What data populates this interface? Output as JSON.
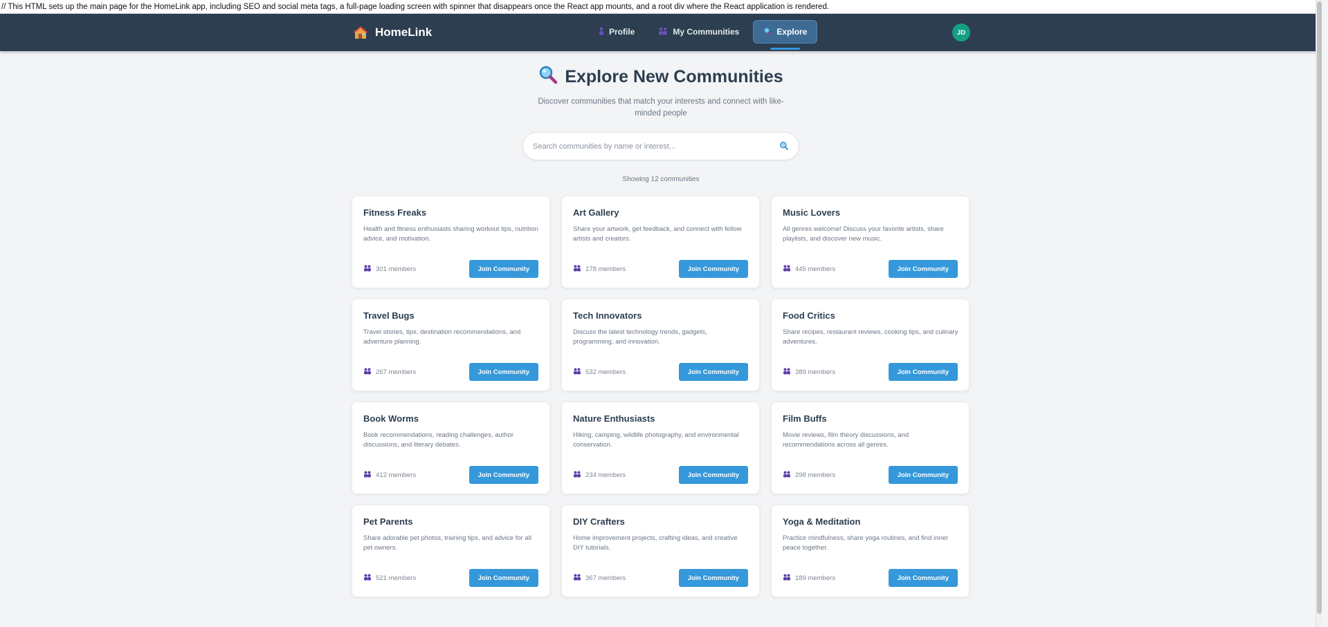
{
  "comment": "// This HTML sets up the main page for the HomeLink app, including SEO and social meta tags, a full-page loading screen with spinner that disappears once the React app mounts, and a root div where the React application is rendered.",
  "brand": {
    "name": "HomeLink",
    "icon": "house-icon"
  },
  "nav": {
    "items": [
      {
        "label": "Profile",
        "icon": "person-icon",
        "active": false
      },
      {
        "label": "My Communities",
        "icon": "people-icon",
        "active": false
      },
      {
        "label": "Explore",
        "icon": "search-icon",
        "active": true
      }
    ]
  },
  "user": {
    "initials": "JD"
  },
  "hero": {
    "title": "Explore New Communities",
    "subtitle": "Discover communities that match your interests and connect with like-minded people"
  },
  "search": {
    "placeholder": "Search communities by name or interest...",
    "value": ""
  },
  "results": {
    "summary": "Showing 12 communities"
  },
  "colors": {
    "navbar": "#2c3e50",
    "accent": "#3498db",
    "avatar": "#16a085",
    "background": "#f3f4f6"
  },
  "communities": [
    {
      "name": "Fitness Freaks",
      "description": "Health and fitness enthusiasts sharing workout tips, nutrition advice, and motivation.",
      "members": "301 members",
      "button": "Join Community"
    },
    {
      "name": "Art Gallery",
      "description": "Share your artwork, get feedback, and connect with fellow artists and creators.",
      "members": "178 members",
      "button": "Join Community"
    },
    {
      "name": "Music Lovers",
      "description": "All genres welcome! Discuss your favorite artists, share playlists, and discover new music.",
      "members": "445 members",
      "button": "Join Community"
    },
    {
      "name": "Travel Bugs",
      "description": "Travel stories, tips, destination recommendations, and adventure planning.",
      "members": "267 members",
      "button": "Join Community"
    },
    {
      "name": "Tech Innovators",
      "description": "Discuss the latest technology trends, gadgets, programming, and innovation.",
      "members": "532 members",
      "button": "Join Community"
    },
    {
      "name": "Food Critics",
      "description": "Share recipes, restaurant reviews, cooking tips, and culinary adventures.",
      "members": "389 members",
      "button": "Join Community"
    },
    {
      "name": "Book Worms",
      "description": "Book recommendations, reading challenges, author discussions, and literary debates.",
      "members": "412 members",
      "button": "Join Community"
    },
    {
      "name": "Nature Enthusiasts",
      "description": "Hiking, camping, wildlife photography, and environmental conservation.",
      "members": "234 members",
      "button": "Join Community"
    },
    {
      "name": "Film Buffs",
      "description": "Movie reviews, film theory discussions, and recommendations across all genres.",
      "members": "298 members",
      "button": "Join Community"
    },
    {
      "name": "Pet Parents",
      "description": "Share adorable pet photos, training tips, and advice for all pet owners.",
      "members": "521 members",
      "button": "Join Community"
    },
    {
      "name": "DIY Crafters",
      "description": "Home improvement projects, crafting ideas, and creative DIY tutorials.",
      "members": "367 members",
      "button": "Join Community"
    },
    {
      "name": "Yoga & Meditation",
      "description": "Practice mindfulness, share yoga routines, and find inner peace together.",
      "members": "189 members",
      "button": "Join Community"
    }
  ]
}
